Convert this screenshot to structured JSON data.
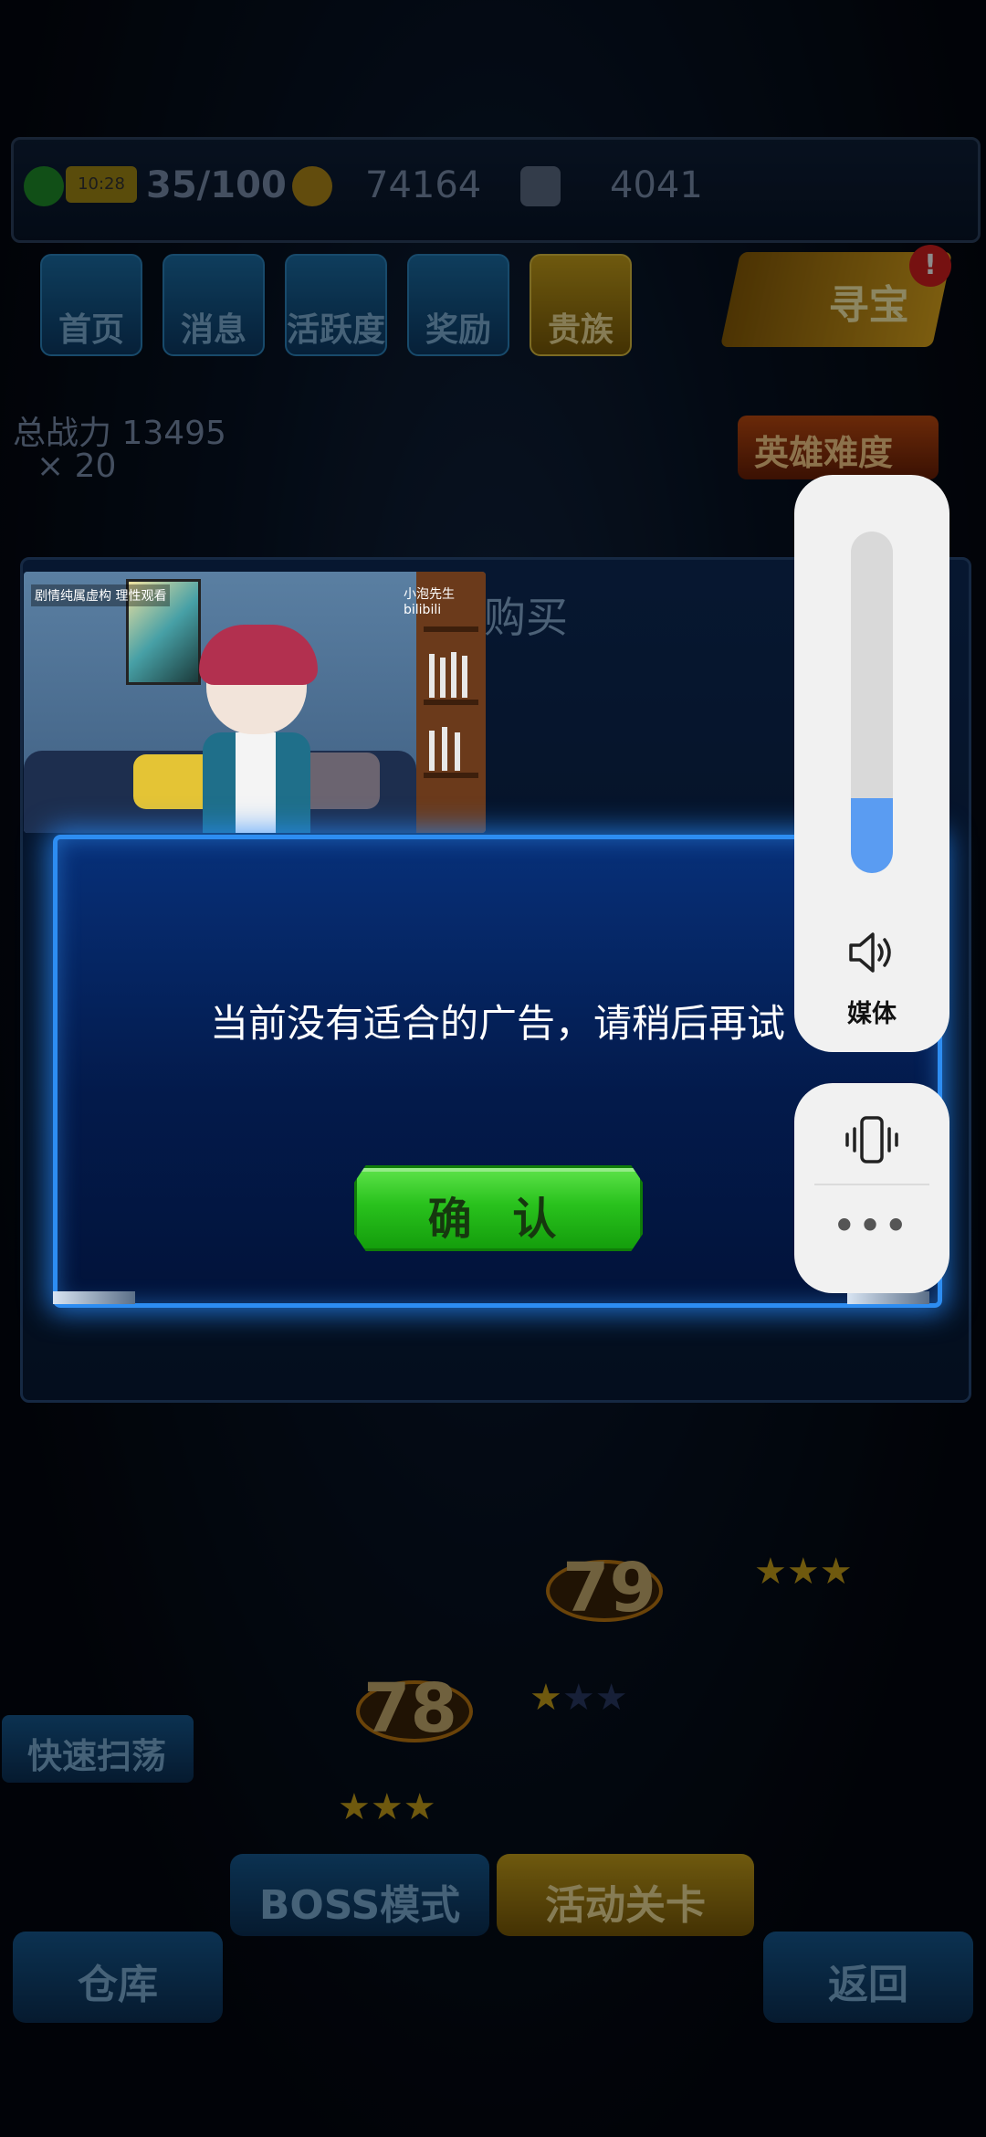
{
  "game_bg": {
    "stamina": "35/100",
    "stamina_badge": "10:28",
    "gold": "74164",
    "diamond": "4041",
    "nav": [
      "首页",
      "消息",
      "活跃度",
      "奖励",
      "贵族"
    ],
    "treasure_label": "寻宝",
    "treasure_badge": "!",
    "power_label": "总战力 13495",
    "power_sub": "× 20",
    "hero_mode_label": "英雄难度",
    "shop_header": "购买",
    "stage_78": "78",
    "stage_79": "79",
    "sweep_label": "快速扫荡",
    "boss_mode": "BOSS模式",
    "event_stage": "活动关卡",
    "warehouse": "仓库",
    "back": "返回"
  },
  "video": {
    "caption": "剧情纯属虚构 理性观看",
    "brand": "小泡先生 bilibili"
  },
  "dialog": {
    "message": "当前没有适合的广告，请稍后再试",
    "confirm_label": "确 认"
  },
  "volume": {
    "level": 0.22,
    "label": "媒体",
    "speaker_icon": "speaker-icon",
    "vibrate_icon": "vibrate-icon",
    "more_icon": "more-icon",
    "more_text": "•••"
  },
  "colors": {
    "dialog_border": "#2d8df2",
    "confirm_green": "#29c21d",
    "volume_fill": "#5a9cf2"
  }
}
